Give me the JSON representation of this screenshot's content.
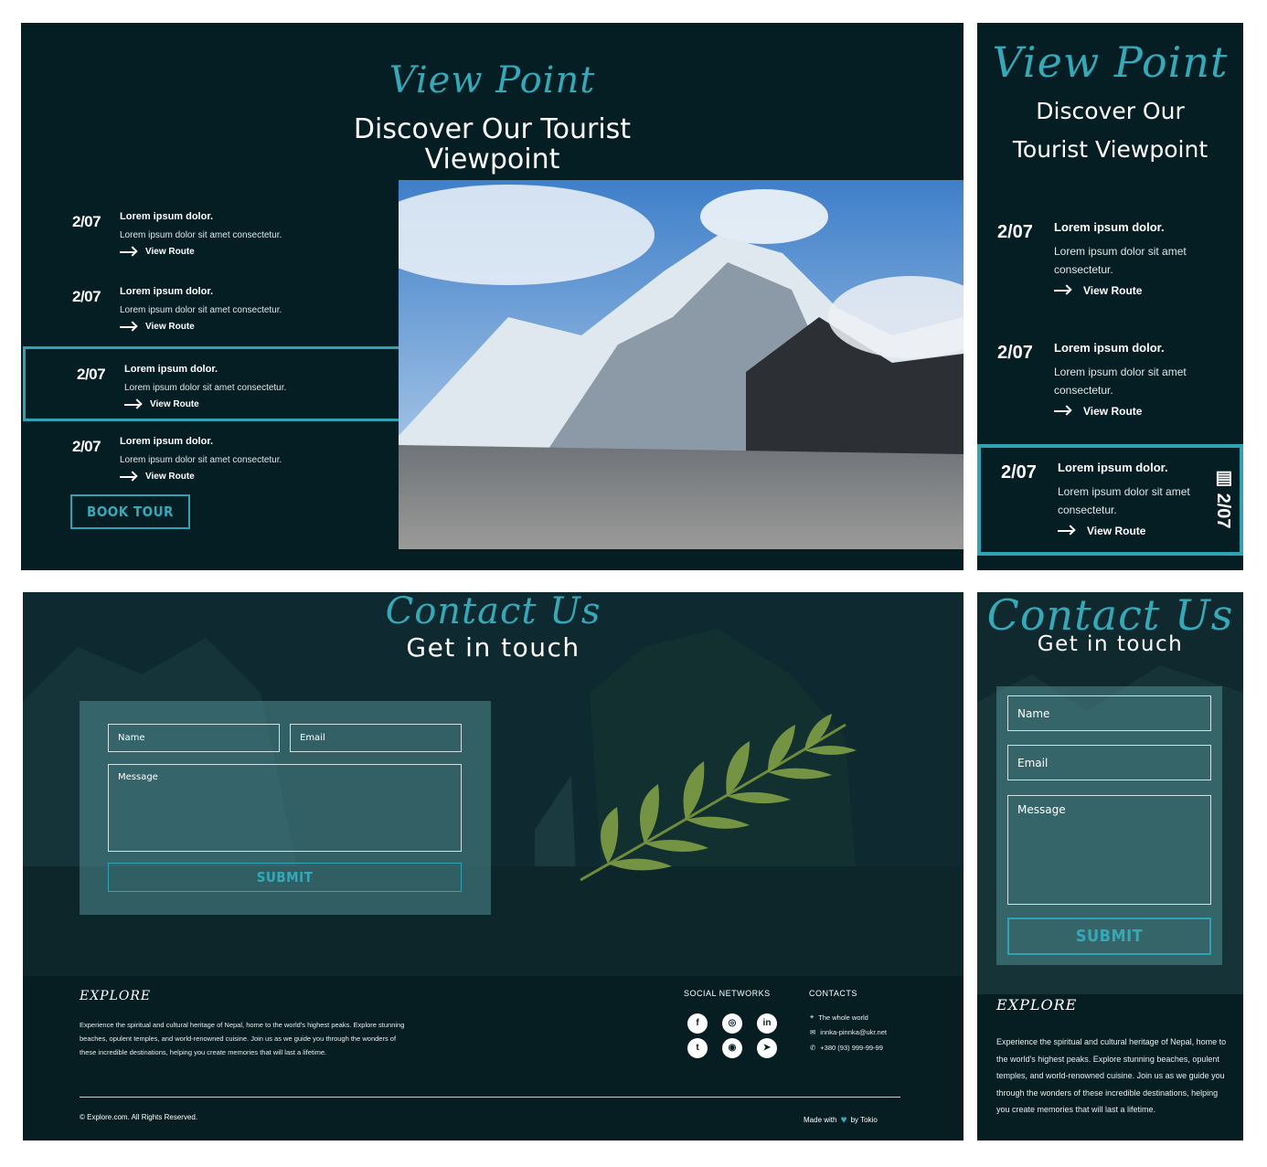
{
  "viewpoint": {
    "script_title": "View Point",
    "subtitle": "Discover Our Tourist Viewpoint",
    "routes": [
      {
        "date": "2/07",
        "title": "Lorem ipsum dolor.",
        "desc": "Lorem ipsum dolor sit amet consectetur.",
        "link": "View Route"
      },
      {
        "date": "2/07",
        "title": "Lorem ipsum dolor.",
        "desc": "Lorem ipsum dolor sit amet consectetur.",
        "link": "View Route"
      },
      {
        "date": "2/07",
        "title": "Lorem ipsum dolor.",
        "desc": "Lorem ipsum dolor sit amet consectetur.",
        "link": "View Route"
      },
      {
        "date": "2/07",
        "title": "Lorem ipsum dolor.",
        "desc": "Lorem ipsum dolor sit amet consectetur.",
        "link": "View Route"
      }
    ],
    "active_tag": "2/07",
    "book_button": "BOOK TOUR"
  },
  "contact": {
    "script_title": "Contact Us",
    "subtitle": "Get in touch",
    "name_placeholder": "Name",
    "email_placeholder": "Email",
    "message_placeholder": "Message",
    "submit_label": "SUBMIT"
  },
  "footer": {
    "logo": "EXPLORE",
    "description": "Experience the spiritual and cultural heritage of Nepal, home to the world's highest peaks. Explore stunning beaches, opulent temples, and world-renowned cuisine. Join us as we guide you through the wonders of these incredible destinations, helping you create memories that will last a lifetime.",
    "social_title": "SOCIAL NETWORKS",
    "contacts_title": "CONTACTS",
    "contacts": {
      "location": "The whole world",
      "email": "innka-pinnka@ukr.net",
      "phone": "+380 (93) 999-99-99"
    },
    "copyright": "© Explore.com. All Rights Reserved.",
    "made_with": "Made with",
    "made_by": "by Tokio"
  },
  "icons": [
    "facebook-icon",
    "instagram-icon",
    "linkedin-icon",
    "twitter-icon",
    "github-icon",
    "telegram-icon",
    "location-icon",
    "mail-icon",
    "phone-icon",
    "arrow-right-icon",
    "heart-icon",
    "calendar-icon"
  ],
  "colors": {
    "accent": "#36a9b8",
    "background": "#051e24"
  }
}
